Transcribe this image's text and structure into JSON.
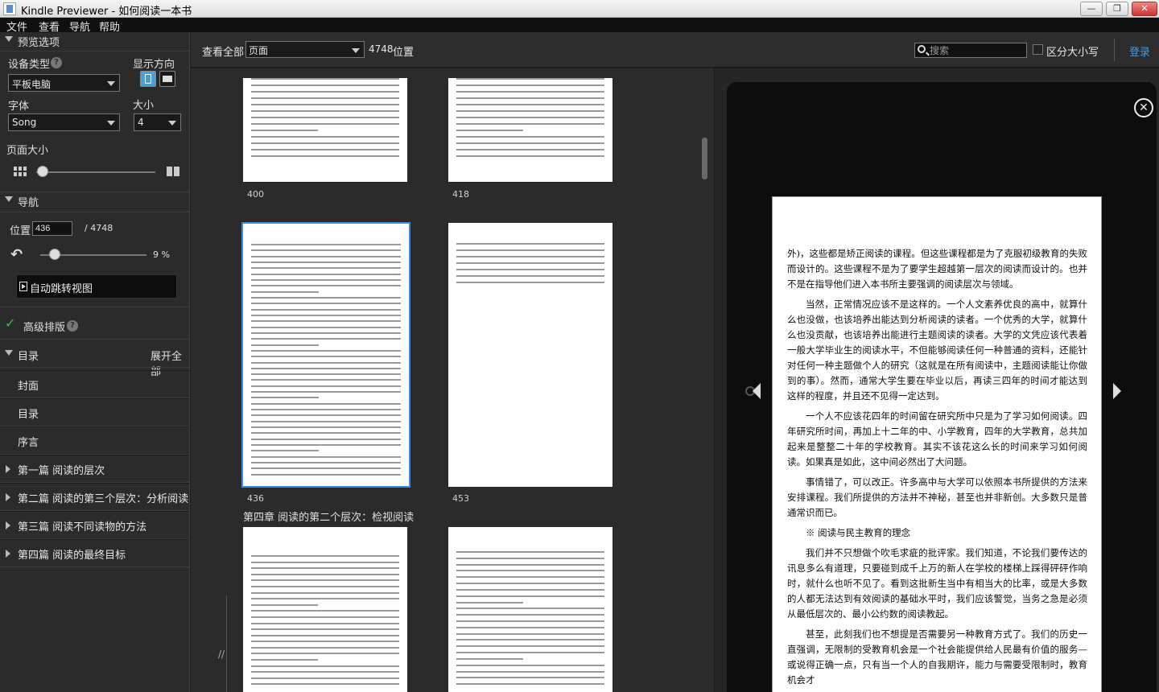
{
  "window": {
    "title": "Kindle Previewer - 如何阅读一本书",
    "minimize": "—",
    "maximize": "❐",
    "close": "✕"
  },
  "menu": [
    "文件",
    "查看",
    "导航",
    "帮助"
  ],
  "sidebar": {
    "preview_options": {
      "header": "预览选项",
      "device_type_label": "设备类型",
      "device_type_value": "平板电脑",
      "orientation_label": "显示方向",
      "font_label": "字体",
      "font_value": "Song",
      "size_label": "大小",
      "size_value": "4",
      "page_size_label": "页面大小"
    },
    "navigation": {
      "header": "导航",
      "location_label": "位置",
      "location_value": "436",
      "location_total": "/ 4748",
      "progress_percent": 9,
      "progress_label": "9 %",
      "auto_jump_label": "自动跳转视图"
    },
    "advanced_layout_label": "高级排版",
    "toc": {
      "header": "目录",
      "expand_all": "展开全部",
      "items": [
        {
          "label": "封面",
          "expandable": false
        },
        {
          "label": "目录",
          "expandable": false
        },
        {
          "label": "序言",
          "expandable": false
        },
        {
          "label": "第一篇  阅读的层次",
          "expandable": true
        },
        {
          "label": "第二篇  阅读的第三个层次：分析阅读",
          "expandable": true
        },
        {
          "label": "第三篇  阅读不同读物的方法",
          "expandable": true
        },
        {
          "label": "第四篇  阅读的最终目标",
          "expandable": true
        }
      ]
    }
  },
  "toolbar": {
    "view_all_label": "查看全部",
    "view_mode_value": "页面",
    "location_count": "4748",
    "location_unit": "位置",
    "search_placeholder": "搜索",
    "match_case_label": "区分大小写",
    "login_label": "登录"
  },
  "grid": {
    "pages": [
      "400",
      "418",
      "436",
      "453"
    ],
    "chapter_heading": "第四章  阅读的第二个层次：检视阅读",
    "grip": "//"
  },
  "reader": {
    "paragraphs": [
      {
        "indent": false,
        "text": "外)，这些都是矫正阅读的课程。但这些课程都是为了克服初级教育的失败而设计的。这些课程不是为了要学生超越第一层次的阅读而设计的。也并不是在指导他们进入本书所主要强调的阅读层次与领域。"
      },
      {
        "indent": true,
        "text": "当然，正常情况应该不是这样的。一个人文素养优良的高中，就算什么也没做，也该培养出能达到分析阅读的读者。一个优秀的大学，就算什么也没贡献，也该培养出能进行主题阅读的读者。大学的文凭应该代表着一般大学毕业生的阅读水平，不但能够阅读任何一种普通的资料，还能针对任何一种主题做个人的研究（这就是在所有阅读中，主题阅读能让你做到的事）。然而，通常大学生要在毕业以后，再读三四年的时间才能达到这样的程度，并且还不见得一定达到。"
      },
      {
        "indent": true,
        "text": "一个人不应该花四年的时间留在研究所中只是为了学习如何阅读。四年研究所时间，再加上十二年的中、小学教育，四年的大学教育，总共加起来是整整二十年的学校教育。其实不该花这么长的时间来学习如何阅读。如果真是如此，这中间必然出了大问题。"
      },
      {
        "indent": true,
        "text": "事情错了，可以改正。许多高中与大学可以依照本书所提供的方法来安排课程。我们所提供的方法并不神秘，甚至也并非新创。大多数只是普通常识而已。"
      },
      {
        "indent": true,
        "text": "※ 阅读与民主教育的理念"
      },
      {
        "indent": true,
        "text": "我们并不只想做个吹毛求疵的批评家。我们知道，不论我们要传达的讯息多么有道理，只要碰到成千上万的新人在学校的楼梯上踩得砰砰作响时，就什么也听不见了。看到这批新生当中有相当大的比率，或是大多数的人都无法达到有效阅读的基础水平时，我们应该警觉，当务之急是必须从最低层次的、最小公约数的阅读教起。"
      },
      {
        "indent": true,
        "text": "甚至，此刻我们也不想提是否需要另一种教育方式了。我们的历史一直强调，无限制的受教育机会是一个社会能提供给人民最有价值的服务—或说得正确一点，只有当一个人的自我期许，能力与需要受限制时，教育机会才"
      }
    ]
  }
}
